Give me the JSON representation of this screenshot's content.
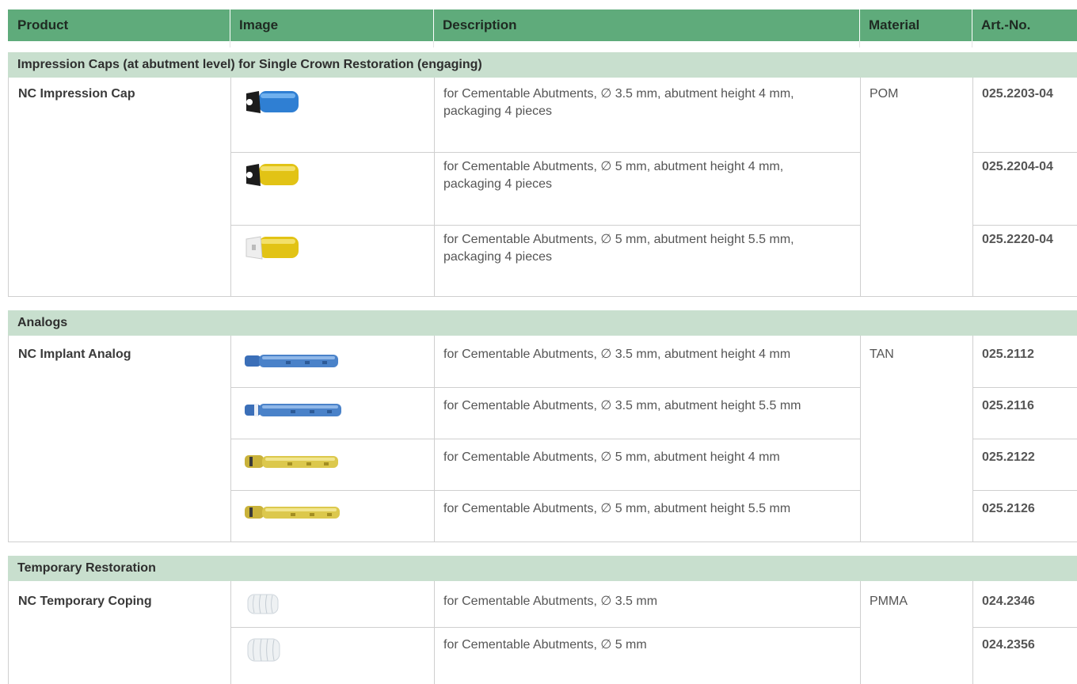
{
  "header": {
    "product": "Product",
    "image": "Image",
    "description": "Description",
    "material": "Material",
    "art_no": "Art.-No."
  },
  "sections": [
    {
      "title": "Impression Caps (at abutment level) for Single Crown Restoration (engaging)",
      "product": "NC Impression Cap",
      "material": "POM",
      "rows": [
        {
          "image": "blue-impression-cap-icon",
          "description": "for Cementable Abutments, ∅ 3.5 mm, abutment height 4 mm, packaging 4 pieces",
          "art_no": "025.2203-04"
        },
        {
          "image": "yellow-impression-cap-icon",
          "description": "for Cementable Abutments, ∅ 5 mm, abutment height 4 mm, packaging 4 pieces",
          "art_no": "025.2204-04"
        },
        {
          "image": "yellow-white-impression-cap-icon",
          "description": "for Cementable Abutments, ∅ 5 mm, abutment height 5.5 mm, packaging 4 pieces",
          "art_no": "025.2220-04"
        }
      ]
    },
    {
      "title": "Analogs",
      "product": "NC Implant Analog",
      "material": "TAN",
      "rows": [
        {
          "image": "blue-implant-analog-icon",
          "description": "for Cementable Abutments, ∅ 3.5 mm, abutment height 4 mm",
          "art_no": "025.2112"
        },
        {
          "image": "blue-implant-analog-long-icon",
          "description": "for Cementable Abutments, ∅ 3.5 mm, abutment height 5.5 mm",
          "art_no": "025.2116"
        },
        {
          "image": "gold-implant-analog-icon",
          "description": "for Cementable Abutments, ∅ 5 mm, abutment height 4 mm",
          "art_no": "025.2122"
        },
        {
          "image": "gold-implant-analog-long-icon",
          "description": "for Cementable Abutments, ∅ 5 mm, abutment height 5.5 mm",
          "art_no": "025.2126"
        }
      ]
    },
    {
      "title": "Temporary Restoration",
      "product": "NC Temporary Coping",
      "material": "PMMA",
      "rows": [
        {
          "image": "clear-temporary-coping-icon",
          "description": "for Cementable Abutments, ∅ 3.5 mm",
          "art_no": "024.2346"
        },
        {
          "image": "clear-temporary-coping-wide-icon",
          "description": "for Cementable Abutments, ∅ 5 mm",
          "art_no": "024.2356"
        }
      ]
    }
  ],
  "colors": {
    "header": "#5fab7b",
    "section": "#c8dfce",
    "grid": "#cfcfcf"
  }
}
